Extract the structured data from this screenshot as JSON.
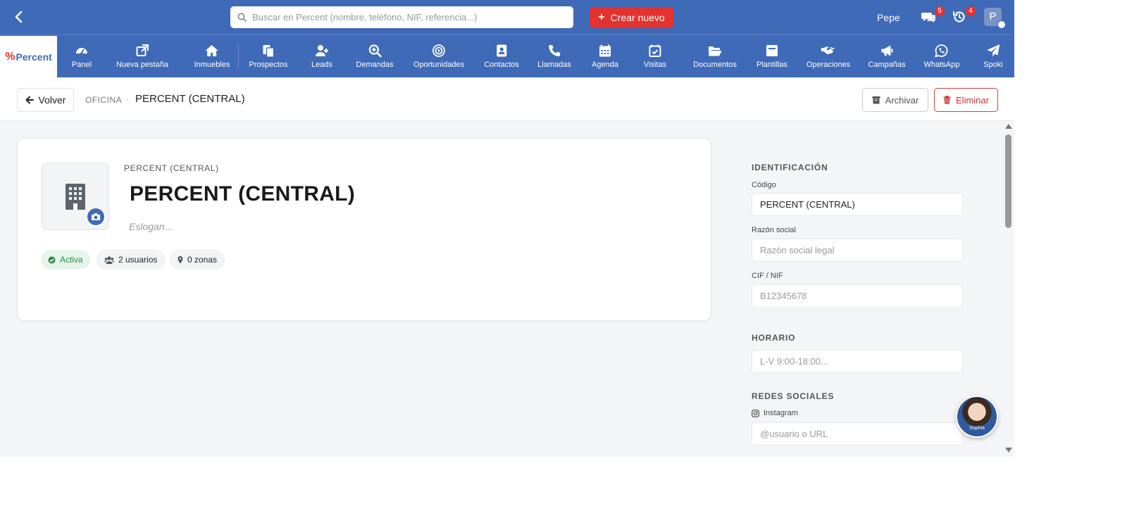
{
  "topbar": {
    "search_placeholder": "Buscar en Percent (nombre, teléfono, NIF, referencia...)",
    "create_label": "Crear nuevo",
    "user_name": "Pepe",
    "messages_badge": "5",
    "notifications_badge": "4",
    "avatar_initial": "P"
  },
  "brand": {
    "logo_text": "Percent"
  },
  "nav": {
    "items": [
      {
        "label": "Panel",
        "icon": "gauge-icon"
      },
      {
        "label": "Nueva pestaña",
        "icon": "external-link-icon"
      },
      {
        "label": "Inmuebles",
        "icon": "home-icon"
      },
      {
        "label": "Prospectos",
        "icon": "copy-icon"
      },
      {
        "label": "Leads",
        "icon": "user-plus-icon"
      },
      {
        "label": "Demandas",
        "icon": "search-plus-icon"
      },
      {
        "label": "Oportunidades",
        "icon": "target-icon"
      },
      {
        "label": "Contactos",
        "icon": "contact-card-icon"
      },
      {
        "label": "Llamadas",
        "icon": "phone-icon"
      },
      {
        "label": "Agenda",
        "icon": "calendar-icon"
      },
      {
        "label": "Visitas",
        "icon": "calendar-check-icon"
      },
      {
        "label": "Documentos",
        "icon": "folder-open-icon"
      },
      {
        "label": "Plantillas",
        "icon": "template-icon"
      },
      {
        "label": "Operaciones",
        "icon": "handshake-icon"
      },
      {
        "label": "Campañas",
        "icon": "megaphone-icon"
      },
      {
        "label": "WhatsApp",
        "icon": "whatsapp-icon"
      },
      {
        "label": "Spoki",
        "icon": "paper-plane-icon"
      }
    ]
  },
  "header": {
    "back_label": "Volver",
    "breadcrumb_parent": "OFICINA",
    "breadcrumb_separator": "·",
    "breadcrumb_current": "PERCENT (CENTRAL)",
    "archive_label": "Archivar",
    "delete_label": "Eliminar"
  },
  "card": {
    "eyebrow": "PERCENT (CENTRAL)",
    "title": "PERCENT (CENTRAL)",
    "slogan_placeholder": "Eslogan...",
    "status_chip": "Activa",
    "users_chip": "2 usuarios",
    "zones_chip": "0 zonas",
    "status_color": "#2e8b4b"
  },
  "details": {
    "identification_title": "IDENTIFICACIÓN",
    "codigo_label": "Código",
    "codigo_value": "PERCENT (CENTRAL)",
    "razon_label": "Razón social",
    "razon_placeholder": "Razón social legal",
    "cif_label": "CIF / NIF",
    "cif_placeholder": "B12345678",
    "schedule_title": "HORARIO",
    "schedule_placeholder": "L-V 9:00-18:00...",
    "social_title": "REDES SOCIALES",
    "instagram_label": "Instagram",
    "instagram_placeholder": "@usuario o URL"
  },
  "assistant": {
    "name": "Sophia"
  },
  "colors": {
    "primary": "#3f6ab8",
    "danger": "#e3322f",
    "success": "#2e8b4b"
  }
}
